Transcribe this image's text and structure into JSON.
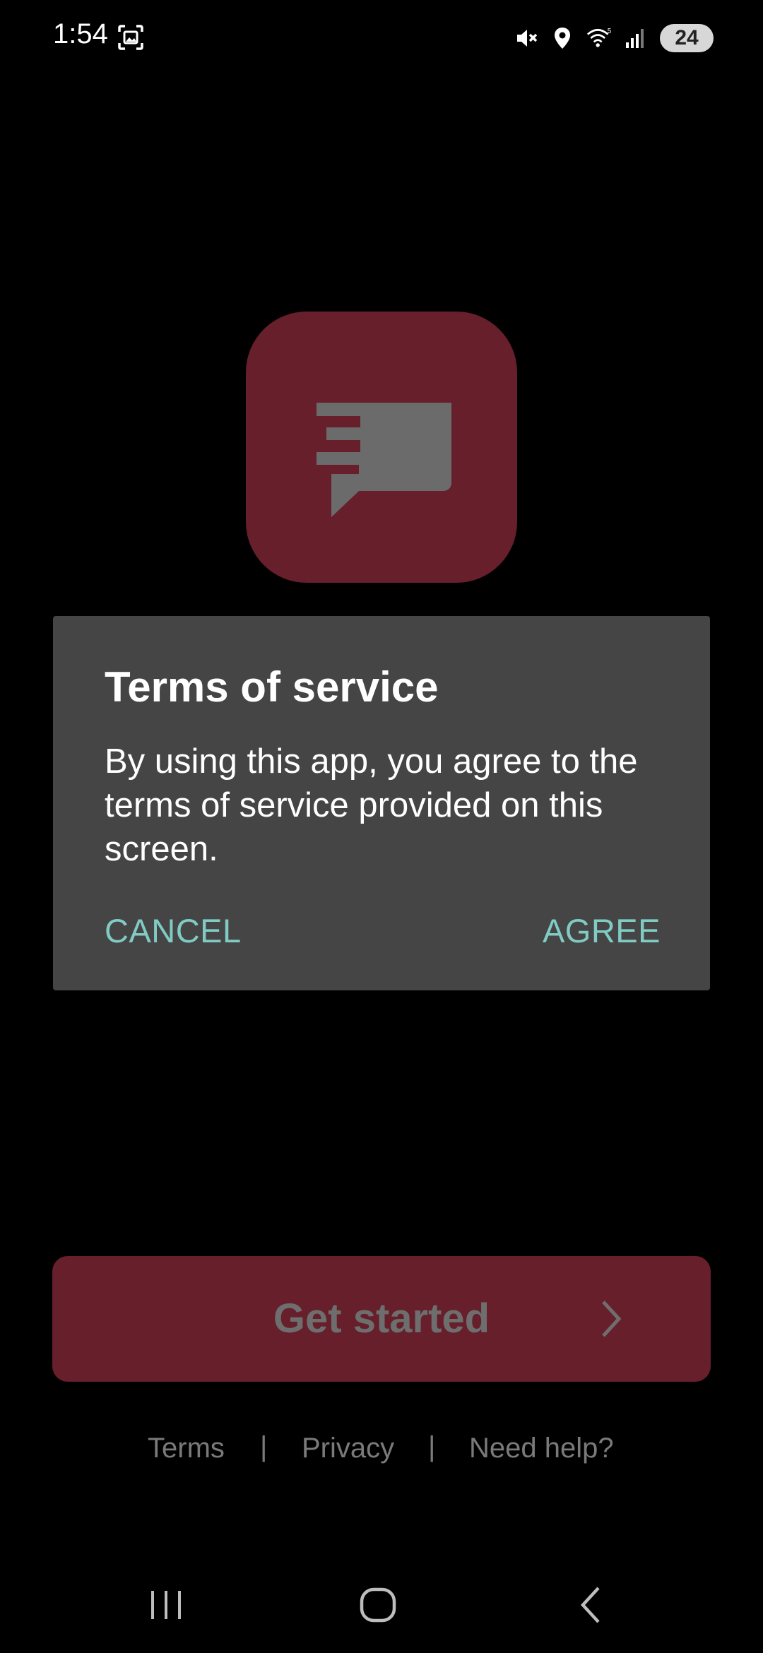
{
  "status_bar": {
    "time": "1:54",
    "battery": "24",
    "icons": [
      "screenshot-icon",
      "mute-icon",
      "location-icon",
      "wifi-icon",
      "signal-icon",
      "battery-icon"
    ]
  },
  "app_icon": {
    "name": "chat-bubble-icon",
    "background": "#661f2b",
    "glyph_color": "#6b6b6b"
  },
  "dialog": {
    "title": "Terms of service",
    "body": "By using this app, you agree to the terms of service provided on this screen.",
    "cancel_label": "CANCEL",
    "agree_label": "AGREE",
    "button_color": "#80cbc4"
  },
  "get_started": {
    "label": "Get started"
  },
  "footer": {
    "terms": "Terms",
    "separator": "|",
    "privacy": "Privacy",
    "help": "Need help?"
  },
  "nav_bar": {
    "icons": [
      "recent-apps-icon",
      "home-icon",
      "back-icon"
    ]
  }
}
